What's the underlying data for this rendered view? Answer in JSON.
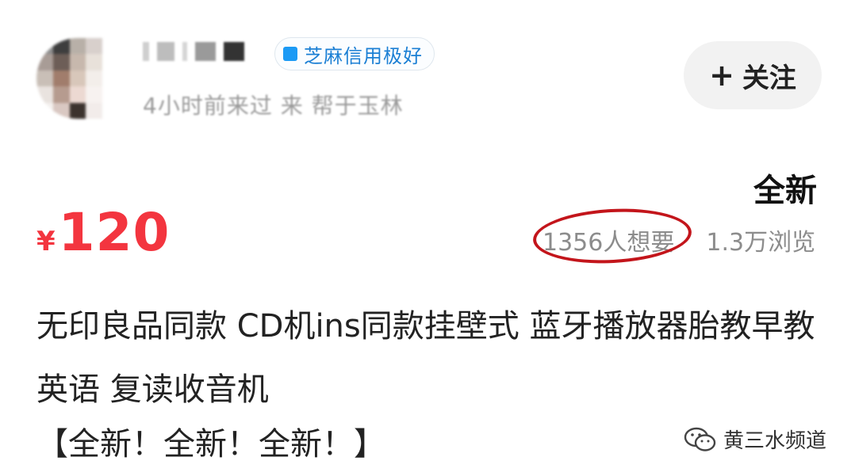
{
  "seller": {
    "credit_badge": "芝麻信用极好",
    "meta": "4小时前来过  来 帮于玉林",
    "follow_label": "关注"
  },
  "listing": {
    "condition": "全新",
    "price_symbol": "¥",
    "price": "120",
    "wants": "1356人想要",
    "views": "1.3万浏览",
    "title": "无印良品同款 CD机ins同款挂壁式 蓝牙播放器胎教早教英语  复读收音机",
    "tag_line": "【全新！全新！全新！】"
  },
  "watermark": {
    "text": "黄三水频道"
  },
  "colors": {
    "price": "#f3353f",
    "annotation_ring": "#c3151b",
    "credit_blue": "#1b9af5",
    "condition_highlight": "#ffe033"
  }
}
